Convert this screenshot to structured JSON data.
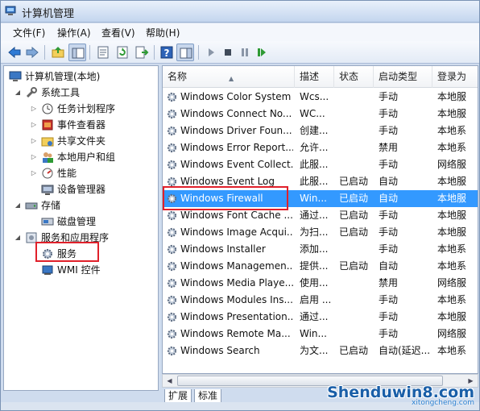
{
  "window": {
    "title": "计算机管理"
  },
  "menu": [
    "文件(F)",
    "操作(A)",
    "查看(V)",
    "帮助(H)"
  ],
  "toolbar": {
    "buttons": [
      "back-icon",
      "forward-icon",
      "up-folder-icon",
      "show-hide-tree-icon",
      "properties-icon",
      "refresh-icon",
      "export-icon",
      "help-icon",
      "view-icon",
      "start-icon",
      "stop-icon",
      "pause-icon",
      "restart-icon"
    ]
  },
  "tree": {
    "root": "计算机管理(本地)",
    "system_tools": "系统工具",
    "task_scheduler": "任务计划程序",
    "event_viewer": "事件查看器",
    "shared_folders": "共享文件夹",
    "local_users": "本地用户和组",
    "performance": "性能",
    "device_manager": "设备管理器",
    "storage": "存储",
    "disk_management": "磁盘管理",
    "services_apps": "服务和应用程序",
    "services": "服务",
    "wmi": "WMI 控件"
  },
  "list": {
    "columns": [
      "名称",
      "描述",
      "状态",
      "启动类型",
      "登录为"
    ],
    "rows": [
      [
        "Windows Color System",
        "Wcs...",
        "",
        "手动",
        "本地服"
      ],
      [
        "Windows Connect No...",
        "WC...",
        "",
        "手动",
        "本地服"
      ],
      [
        "Windows Driver Foun...",
        "创建...",
        "",
        "手动",
        "本地系"
      ],
      [
        "Windows Error Report...",
        "允许...",
        "",
        "禁用",
        "本地系"
      ],
      [
        "Windows Event Collect...",
        "此服...",
        "",
        "手动",
        "网络服"
      ],
      [
        "Windows Event Log",
        "此服...",
        "已启动",
        "自动",
        "本地服"
      ],
      [
        "Windows Firewall",
        "Win...",
        "已启动",
        "自动",
        "本地服"
      ],
      [
        "Windows Font Cache ...",
        "通过...",
        "已启动",
        "手动",
        "本地服"
      ],
      [
        "Windows Image Acqui...",
        "为扫...",
        "已启动",
        "手动",
        "本地服"
      ],
      [
        "Windows Installer",
        "添加...",
        "",
        "手动",
        "本地系"
      ],
      [
        "Windows Managemen...",
        "提供...",
        "已启动",
        "自动",
        "本地系"
      ],
      [
        "Windows Media Playe...",
        "使用...",
        "",
        "禁用",
        "网络服"
      ],
      [
        "Windows Modules Ins...",
        "启用 ...",
        "",
        "手动",
        "本地系"
      ],
      [
        "Windows Presentation...",
        "通过...",
        "",
        "手动",
        "本地服"
      ],
      [
        "Windows Remote Ma...",
        "Win...",
        "",
        "手动",
        "网络服"
      ],
      [
        "Windows Search",
        "为文...",
        "已启动",
        "自动(延迟...",
        "本地系"
      ]
    ],
    "selected_index": 6
  },
  "tabs": [
    "扩展",
    "标准"
  ],
  "watermark": {
    "main": "Shenduwin8.com",
    "sub": "xitongcheng.com"
  },
  "colors": {
    "selection": "#3399ff",
    "highlight": "#e0202a"
  }
}
